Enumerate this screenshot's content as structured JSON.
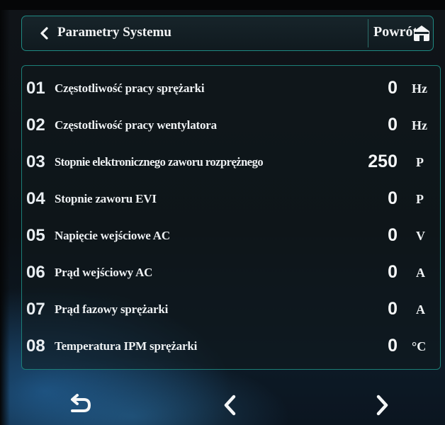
{
  "header": {
    "title": "Parametry Systemu",
    "return_label": "Powrót"
  },
  "parameters": [
    {
      "num": "01",
      "label": "Częstotliwość pracy sprężarki",
      "value": "0",
      "unit": "Hz"
    },
    {
      "num": "02",
      "label": "Częstotliwość pracy wentylatora",
      "value": "0",
      "unit": "Hz"
    },
    {
      "num": "03",
      "label": "Stopnie elektronicznego zaworu rozprężnego",
      "value": "250",
      "unit": "P"
    },
    {
      "num": "04",
      "label": "Stopnie zaworu EVI",
      "value": "0",
      "unit": "P"
    },
    {
      "num": "05",
      "label": "Napięcie wejściowe AC",
      "value": "0",
      "unit": "V"
    },
    {
      "num": "06",
      "label": "Prąd wejściowy AC",
      "value": "0",
      "unit": "A"
    },
    {
      "num": "07",
      "label": "Prąd fazowy sprężarki",
      "value": "0",
      "unit": "A"
    },
    {
      "num": "08",
      "label": "Temperatura IPM sprężarki",
      "value": "0",
      "unit": "°C"
    }
  ],
  "nav": {
    "icons": [
      "return-arrow-icon",
      "chevron-left-icon",
      "chevron-right-icon"
    ]
  },
  "colors": {
    "accent_border": "#1f8a83",
    "text": "#f2f4f5",
    "background": "#0c1116"
  }
}
